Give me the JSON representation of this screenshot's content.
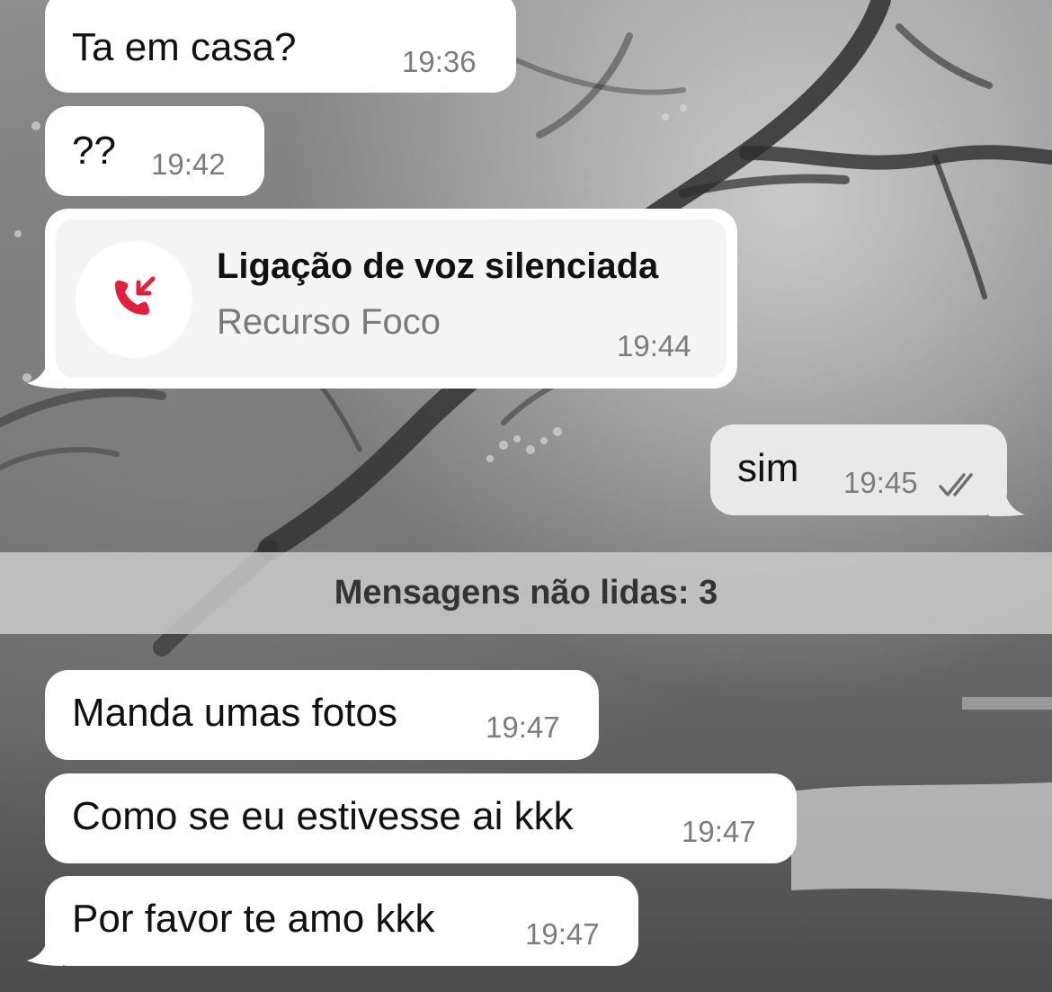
{
  "chat": {
    "messages": [
      {
        "direction": "incoming",
        "text": "Ta em casa?",
        "time": "19:36"
      },
      {
        "direction": "incoming",
        "text": "??",
        "time": "19:42"
      },
      {
        "direction": "outgoing",
        "text": "sim",
        "time": "19:45",
        "status_icon": "double-check-read-icon"
      },
      {
        "direction": "incoming",
        "text": "Manda umas fotos",
        "time": "19:47"
      },
      {
        "direction": "incoming",
        "text": "Como se eu estivesse ai kkk",
        "time": "19:47"
      },
      {
        "direction": "incoming",
        "text": "Por favor te amo kkk",
        "time": "19:47"
      }
    ],
    "call": {
      "title": "Ligação de voz silenciada",
      "subtitle": "Recurso Foco",
      "time": "19:44",
      "icon": "missed-call-icon",
      "icon_color": "#e0213b"
    },
    "unread_divider": "Mensagens não lidas: 3"
  },
  "colors": {
    "incoming_bubble": "#ffffff",
    "outgoing_bubble": "#e8e9e8",
    "timestamp": "#7c7c7c",
    "missed_call_accent": "#e0213b"
  },
  "wallpaper": "misty-forest-river"
}
